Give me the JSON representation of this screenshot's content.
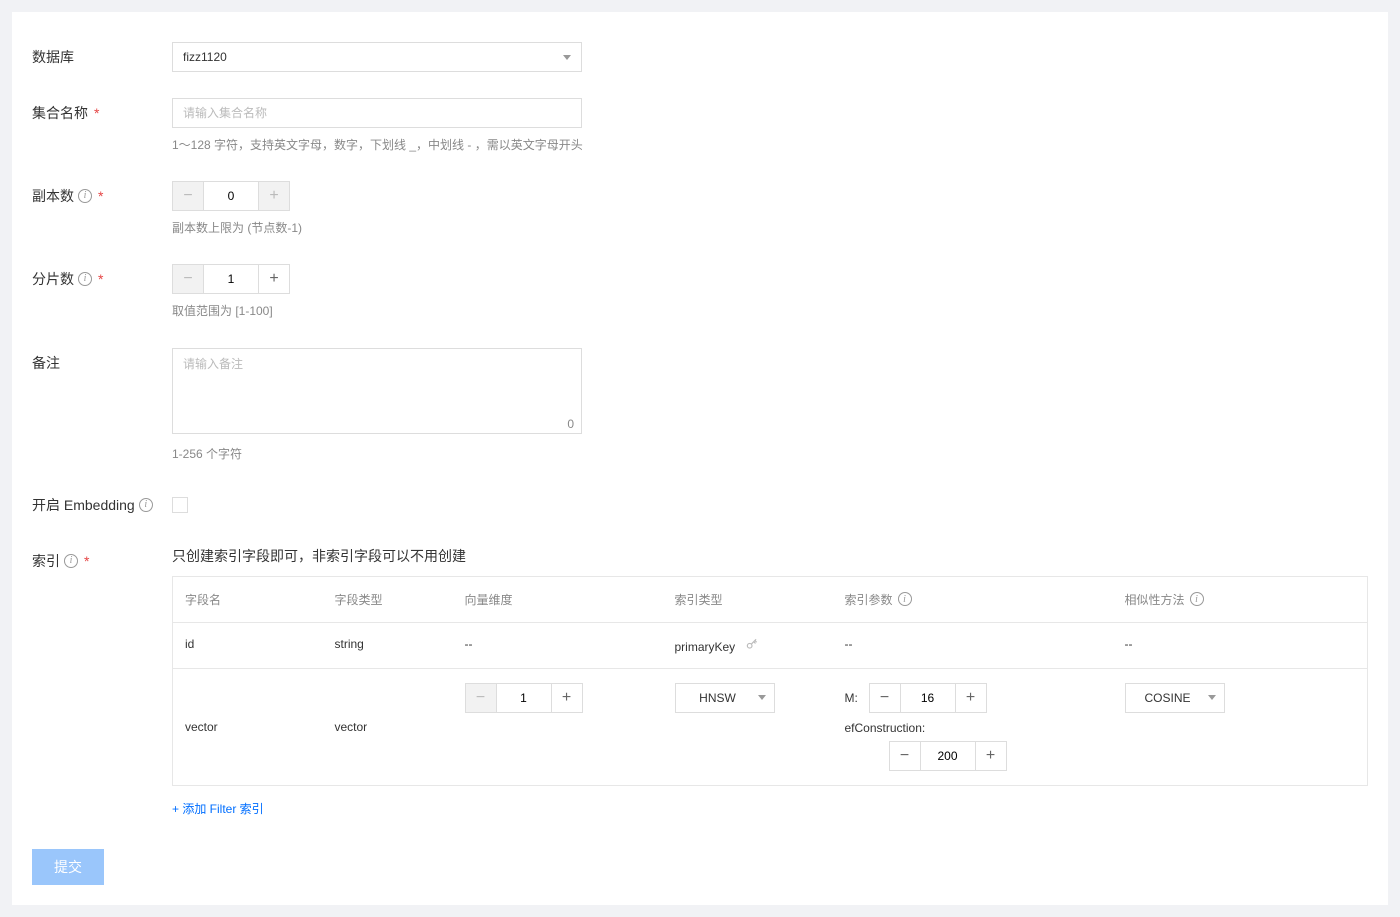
{
  "labels": {
    "database": "数据库",
    "collectionName": "集合名称",
    "replicas": "副本数",
    "shards": "分片数",
    "remark": "备注",
    "enableEmbedding": "开启 Embedding",
    "index": "索引"
  },
  "database": {
    "selected": "fizz1120"
  },
  "collection": {
    "placeholder": "请输入集合名称",
    "helper": "1～128 字符，支持英文字母，数字，下划线 _，中划线 - ，需以英文字母开头"
  },
  "replicas": {
    "value": "0",
    "helper": "副本数上限为 (节点数-1)"
  },
  "shards": {
    "value": "1",
    "helper": "取值范围为 [1-100]"
  },
  "remark": {
    "placeholder": "请输入备注",
    "charCount": "0",
    "helper": "1-256 个字符"
  },
  "indexNote": "只创建索引字段即可，非索引字段可以不用创建",
  "tableHeaders": {
    "fieldName": "字段名",
    "fieldType": "字段类型",
    "vectorDim": "向量维度",
    "indexType": "索引类型",
    "indexParam": "索引参数",
    "similarity": "相似性方法"
  },
  "rows": {
    "id": {
      "name": "id",
      "type": "string",
      "dim": "--",
      "indexType": "primaryKey",
      "indexParam": "--",
      "similarity": "--"
    },
    "vector": {
      "name": "vector",
      "type": "vector",
      "dimValue": "1",
      "indexTypeSelected": "HNSW",
      "params": {
        "mLabel": "M:",
        "mValue": "16",
        "efLabel": "efConstruction:",
        "efValue": "200"
      },
      "similaritySelected": "COSINE"
    }
  },
  "addFilterLink": "+ 添加 Filter 索引",
  "submit": "提交"
}
